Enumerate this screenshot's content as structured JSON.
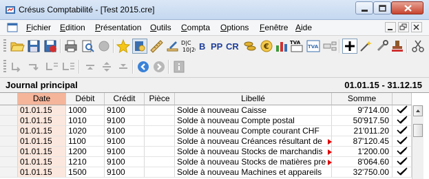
{
  "window": {
    "title": "Crésus Comptabilité - [Test 2015.cre]"
  },
  "menu": {
    "items": [
      {
        "label": "Fichier"
      },
      {
        "label": "Edition"
      },
      {
        "label": "Présentation"
      },
      {
        "label": "Outils"
      },
      {
        "label": "Compta"
      },
      {
        "label": "Options"
      },
      {
        "label": "Fenêtre"
      },
      {
        "label": "Aide"
      }
    ]
  },
  "toolbar": {
    "b_label": "B",
    "pp_label": "PP",
    "cr_label": "CR",
    "tva_label": "TVA",
    "dc_label": "D|C"
  },
  "journal": {
    "title": "Journal principal",
    "period": "01.01.15 - 31.12.15",
    "columns": [
      "Date",
      "Débit",
      "Crédit",
      "Pièce",
      "Libellé",
      "Somme"
    ],
    "rows": [
      {
        "date": "01.01.15",
        "debit": "1000",
        "credit": "9100",
        "piece": "",
        "libelle": "Solde à nouveau Caisse",
        "somme": "9'714.00",
        "truncated": false
      },
      {
        "date": "01.01.15",
        "debit": "1010",
        "credit": "9100",
        "piece": "",
        "libelle": "Solde à nouveau Compte postal",
        "somme": "50'917.50",
        "truncated": false
      },
      {
        "date": "01.01.15",
        "debit": "1020",
        "credit": "9100",
        "piece": "",
        "libelle": "Solde à nouveau Compte courant CHF",
        "somme": "21'011.20",
        "truncated": false
      },
      {
        "date": "01.01.15",
        "debit": "1100",
        "credit": "9100",
        "piece": "",
        "libelle": "Solde à nouveau Créances résultant de",
        "somme": "87'120.45",
        "truncated": true
      },
      {
        "date": "01.01.15",
        "debit": "1200",
        "credit": "9100",
        "piece": "",
        "libelle": "Solde à nouveau Stocks de marchandis",
        "somme": "1'200.00",
        "truncated": true
      },
      {
        "date": "01.01.15",
        "debit": "1210",
        "credit": "9100",
        "piece": "",
        "libelle": "Solde à nouveau Stocks de matières pre",
        "somme": "8'064.60",
        "truncated": true
      },
      {
        "date": "01.01.15",
        "debit": "1500",
        "credit": "9100",
        "piece": "",
        "libelle": "Solde à nouveau Machines et appareils",
        "somme": "32'750.00",
        "truncated": false
      }
    ]
  }
}
